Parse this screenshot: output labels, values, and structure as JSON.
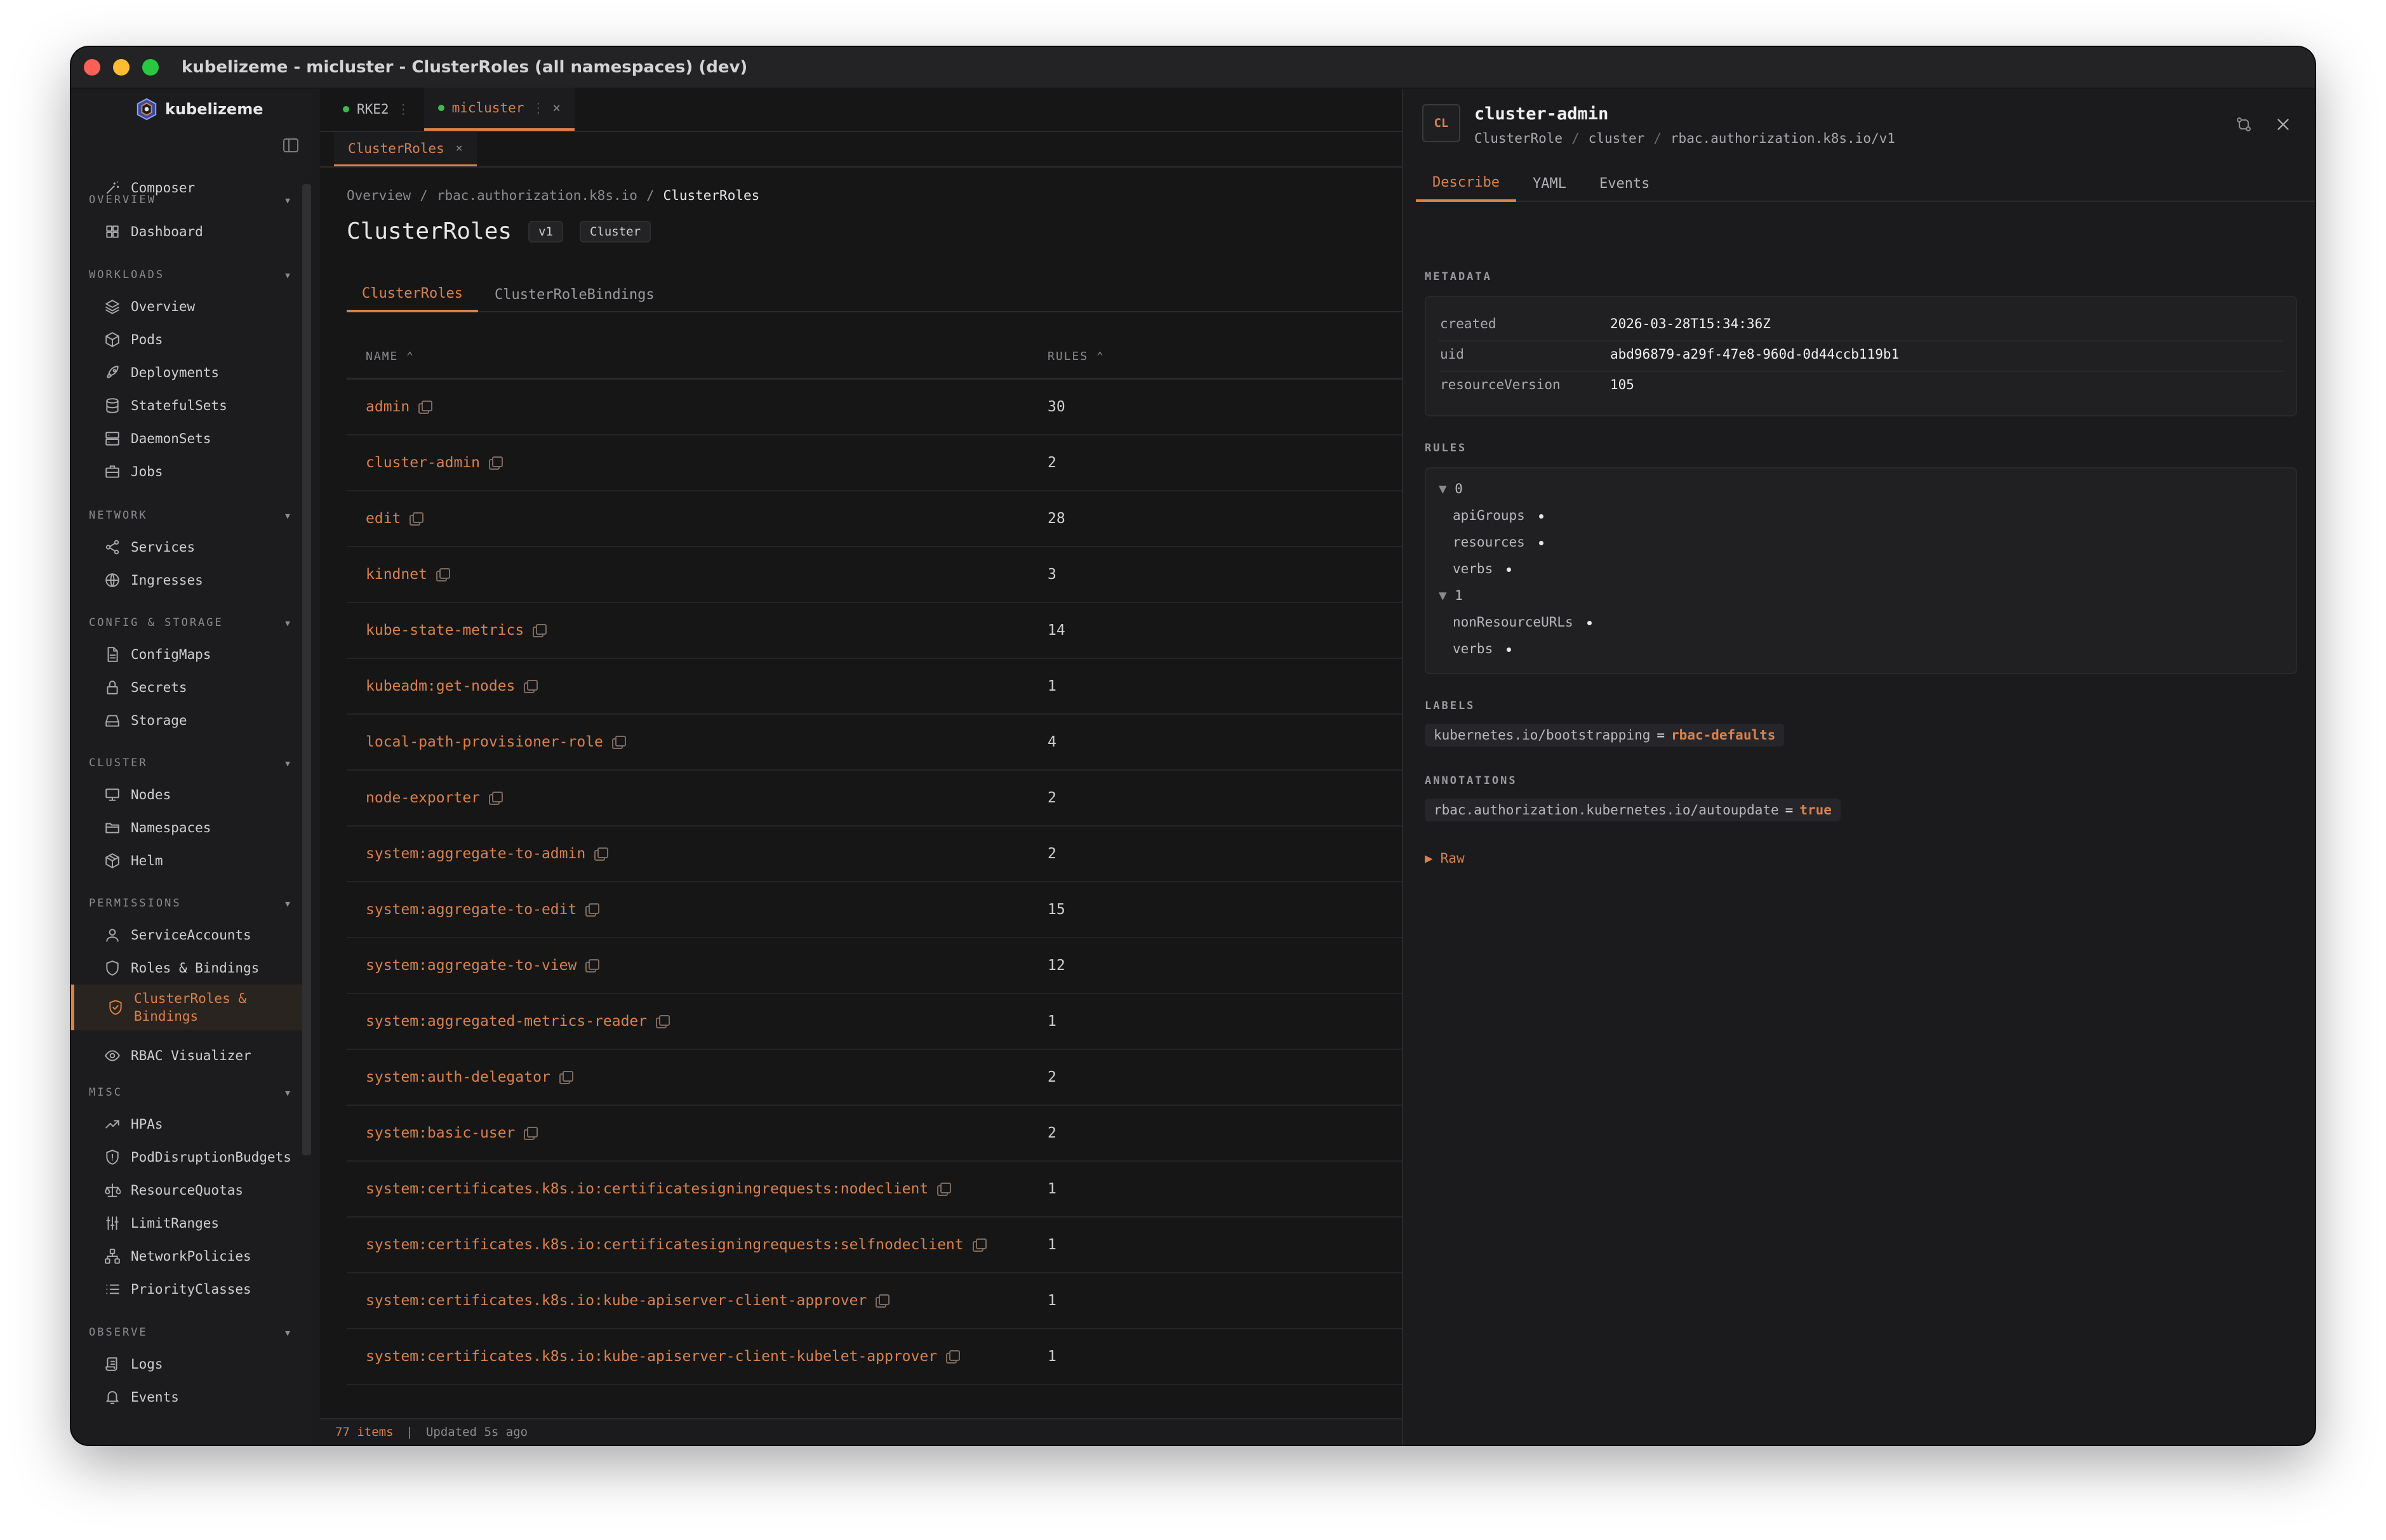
{
  "window": {
    "title": "kubelizeme - micluster - ClusterRoles (all namespaces) (dev)"
  },
  "brand": {
    "name": "kubelizeme"
  },
  "sidebar": {
    "composer": "Composer",
    "sections": [
      {
        "label": "OVERVIEW",
        "items": [
          {
            "label": "Dashboard",
            "icon": "grid-icon"
          }
        ]
      },
      {
        "label": "WORKLOADS",
        "items": [
          {
            "label": "Overview",
            "icon": "layers-icon"
          },
          {
            "label": "Pods",
            "icon": "cube-icon"
          },
          {
            "label": "Deployments",
            "icon": "rocket-icon"
          },
          {
            "label": "StatefulSets",
            "icon": "database-icon"
          },
          {
            "label": "DaemonSets",
            "icon": "server-icon"
          },
          {
            "label": "Jobs",
            "icon": "briefcase-icon"
          }
        ]
      },
      {
        "label": "NETWORK",
        "items": [
          {
            "label": "Services",
            "icon": "share-icon"
          },
          {
            "label": "Ingresses",
            "icon": "globe-icon"
          }
        ]
      },
      {
        "label": "CONFIG & STORAGE",
        "items": [
          {
            "label": "ConfigMaps",
            "icon": "file-icon"
          },
          {
            "label": "Secrets",
            "icon": "lock-icon"
          },
          {
            "label": "Storage",
            "icon": "drive-icon"
          }
        ]
      },
      {
        "label": "CLUSTER",
        "items": [
          {
            "label": "Nodes",
            "icon": "monitor-icon"
          },
          {
            "label": "Namespaces",
            "icon": "folder-icon"
          },
          {
            "label": "Helm",
            "icon": "package-icon"
          }
        ]
      },
      {
        "label": "PERMISSIONS",
        "items": [
          {
            "label": "ServiceAccounts",
            "icon": "user-icon"
          },
          {
            "label": "Roles & Bindings",
            "icon": "shield-icon"
          },
          {
            "label": "ClusterRoles &",
            "label2": "Bindings",
            "icon": "shield-check-icon",
            "active": true
          },
          {
            "label": "RBAC Visualizer",
            "icon": "eye-icon"
          }
        ]
      },
      {
        "label": "MISC",
        "items": [
          {
            "label": "HPAs",
            "icon": "trend-icon"
          },
          {
            "label": "PodDisruptionBudgets",
            "icon": "shield-alert-icon"
          },
          {
            "label": "ResourceQuotas",
            "icon": "scale-icon"
          },
          {
            "label": "LimitRanges",
            "icon": "sliders-icon"
          },
          {
            "label": "NetworkPolicies",
            "icon": "network-icon"
          },
          {
            "label": "PriorityClasses",
            "icon": "list-icon"
          }
        ]
      },
      {
        "label": "OBSERVE",
        "items": [
          {
            "label": "Logs",
            "icon": "scroll-icon"
          },
          {
            "label": "Events",
            "icon": "bell-icon"
          }
        ]
      }
    ]
  },
  "context_tabs": [
    {
      "label": "RKE2",
      "sep": "⋮"
    },
    {
      "label": "micluster",
      "sep": "⋮",
      "close": "×"
    }
  ],
  "page_tab": {
    "label": "ClusterRoles",
    "close": "×"
  },
  "breadcrumb": [
    "Overview",
    "rbac.authorization.k8s.io",
    "ClusterRoles"
  ],
  "breadcrumb_sep": "/",
  "page": {
    "title": "ClusterRoles",
    "badges": [
      "v1",
      "Cluster"
    ]
  },
  "subtabs": [
    "ClusterRoles",
    "ClusterRoleBindings"
  ],
  "table": {
    "columns": {
      "name": "NAME ⌃",
      "rules": "RULES ⌃"
    },
    "rows": [
      {
        "name": "admin",
        "rules": "30"
      },
      {
        "name": "cluster-admin",
        "rules": "2"
      },
      {
        "name": "edit",
        "rules": "28"
      },
      {
        "name": "kindnet",
        "rules": "3"
      },
      {
        "name": "kube-state-metrics",
        "rules": "14"
      },
      {
        "name": "kubeadm:get-nodes",
        "rules": "1"
      },
      {
        "name": "local-path-provisioner-role",
        "rules": "4"
      },
      {
        "name": "node-exporter",
        "rules": "2"
      },
      {
        "name": "system:aggregate-to-admin",
        "rules": "2"
      },
      {
        "name": "system:aggregate-to-edit",
        "rules": "15"
      },
      {
        "name": "system:aggregate-to-view",
        "rules": "12"
      },
      {
        "name": "system:aggregated-metrics-reader",
        "rules": "1"
      },
      {
        "name": "system:auth-delegator",
        "rules": "2"
      },
      {
        "name": "system:basic-user",
        "rules": "2"
      },
      {
        "name": "system:certificates.k8s.io:certificatesigningrequests:nodeclient",
        "rules": "1"
      },
      {
        "name": "system:certificates.k8s.io:certificatesigningrequests:selfnodeclient",
        "rules": "1"
      },
      {
        "name": "system:certificates.k8s.io:kube-apiserver-client-approver",
        "rules": "1"
      },
      {
        "name": "system:certificates.k8s.io:kube-apiserver-client-kubelet-approver",
        "rules": "1"
      }
    ]
  },
  "status": {
    "count": "77 items",
    "sep": "|",
    "updated": "Updated 5s ago"
  },
  "detail": {
    "avatar": "CL",
    "title": "cluster-admin",
    "sub": [
      "ClusterRole",
      "cluster",
      "rbac.authorization.k8s.io/v1"
    ],
    "tabs": [
      "Describe",
      "YAML",
      "Events"
    ],
    "metadata_label": "METADATA",
    "metadata": [
      {
        "k": "created",
        "v": "2026-03-28T15:34:36Z"
      },
      {
        "k": "uid",
        "v": "abd96879-a29f-47e8-960d-0d44ccb119b1"
      },
      {
        "k": "resourceVersion",
        "v": "105"
      }
    ],
    "rules_label": "RULES",
    "rules": [
      {
        "index": "0",
        "fields": [
          "apiGroups",
          "resources",
          "verbs"
        ]
      },
      {
        "index": "1",
        "fields": [
          "nonResourceURLs",
          "verbs"
        ]
      }
    ],
    "labels_label": "LABELS",
    "label": {
      "key": "kubernetes.io/bootstrapping",
      "eq": "=",
      "val": "rbac-defaults"
    },
    "annotations_label": "ANNOTATIONS",
    "annotation": {
      "key": "rbac.authorization.kubernetes.io/autoupdate",
      "eq": "=",
      "val": "true"
    },
    "raw": "Raw"
  },
  "colors": {
    "accent": "#d9824b",
    "bg": "#161617",
    "panel": "#1b1b1d",
    "status_ok": "#3fb950"
  }
}
